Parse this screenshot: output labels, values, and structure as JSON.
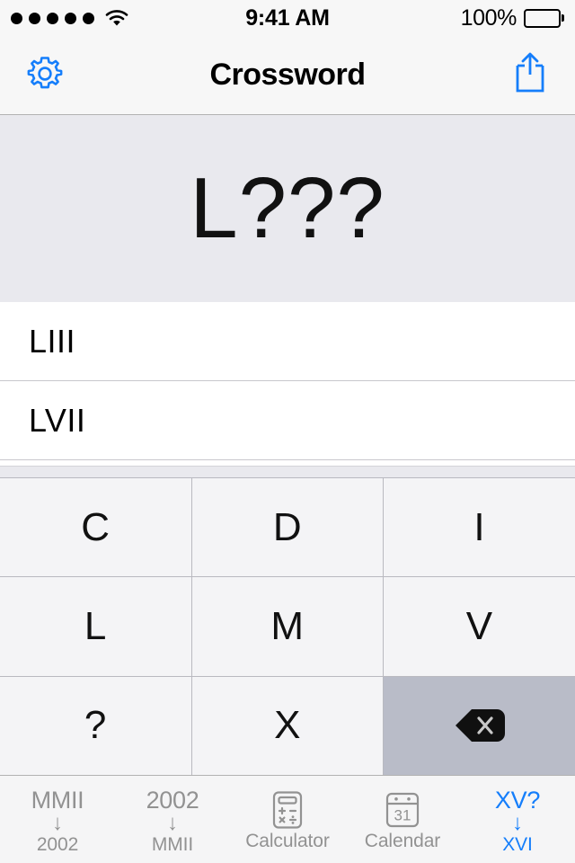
{
  "status_bar": {
    "signal_dots": 5,
    "wifi_icon": "wifi-icon",
    "time": "9:41 AM",
    "battery_percent": "100%",
    "battery_icon": "battery-full-icon"
  },
  "nav_bar": {
    "title": "Crossword",
    "left_icon": "gear-icon",
    "right_icon": "share-icon",
    "accent_color": "#157efb"
  },
  "pattern_display": {
    "pattern": "L???",
    "background_color": "#e9e9ee"
  },
  "results": {
    "items": [
      {
        "value": "LIII"
      },
      {
        "value": "LVII"
      }
    ]
  },
  "keyboard": {
    "rows": [
      [
        {
          "label": "C",
          "name": "key-c",
          "state": "normal"
        },
        {
          "label": "D",
          "name": "key-d",
          "state": "normal"
        },
        {
          "label": "I",
          "name": "key-i",
          "state": "normal"
        }
      ],
      [
        {
          "label": "L",
          "name": "key-l",
          "state": "normal"
        },
        {
          "label": "M",
          "name": "key-m",
          "state": "normal"
        },
        {
          "label": "V",
          "name": "key-v",
          "state": "normal"
        }
      ],
      [
        {
          "label": "?",
          "name": "key-question",
          "state": "normal"
        },
        {
          "label": "X",
          "name": "key-x",
          "state": "normal"
        },
        {
          "label": "",
          "name": "key-delete",
          "state": "pressed",
          "icon": "delete-backward-icon"
        }
      ]
    ],
    "key_color": "#f4f4f6",
    "pressed_color": "#b9bcc8"
  },
  "tab_bar": {
    "items": [
      {
        "name": "tab-roman-to-arabic",
        "top": "MMII",
        "arrow": "↓",
        "label": "2002",
        "icon": null,
        "active": false
      },
      {
        "name": "tab-arabic-to-roman",
        "top": "2002",
        "arrow": "↓",
        "label": "MMII",
        "icon": null,
        "active": false
      },
      {
        "name": "tab-calculator",
        "top": null,
        "arrow": null,
        "label": "Calculator",
        "icon": "calculator-icon",
        "active": false
      },
      {
        "name": "tab-calendar",
        "top": null,
        "arrow": null,
        "label": "Calendar",
        "icon": "calendar-icon",
        "active": false
      },
      {
        "name": "tab-crossword",
        "top": "XV?",
        "arrow": "↓",
        "label": "XVI",
        "icon": null,
        "active": true
      }
    ],
    "inactive_color": "#929292",
    "active_color": "#157efb"
  }
}
